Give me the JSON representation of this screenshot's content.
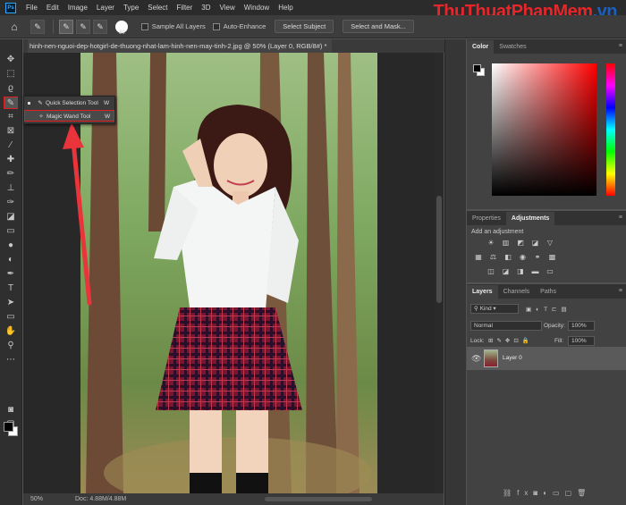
{
  "app": {
    "logo": "Ps",
    "menu": [
      "File",
      "Edit",
      "Image",
      "Layer",
      "Type",
      "Select",
      "Filter",
      "3D",
      "View",
      "Window",
      "Help"
    ],
    "watermark": {
      "part1": "ThuThuat",
      "part2": "PhanMem",
      "part3": ".vn"
    }
  },
  "options": {
    "brush_size": "30",
    "sample_all_layers": "Sample All Layers",
    "auto_enhance": "Auto-Enhance",
    "select_subject": "Select Subject",
    "select_and_mask": "Select and Mask..."
  },
  "document": {
    "tab_title": "hinh-nen-nguoi-dep-hotgirl-de-thuong-nhat-lam-hinh-nen-may-tinh-2.jpg @ 50% (Layer 0, RGB/8#) *",
    "zoom": "50%",
    "doc_size": "Doc: 4.88M/4.88M"
  },
  "flyout": {
    "items": [
      {
        "label": "Quick Selection Tool",
        "key": "W",
        "icon": "quick-selection-icon",
        "active": true
      },
      {
        "label": "Magic Wand Tool",
        "key": "W",
        "icon": "magic-wand-icon",
        "highlighted": true
      }
    ]
  },
  "tools": [
    "move-icon",
    "marquee-icon",
    "lasso-icon",
    "quick-selection-icon",
    "crop-icon",
    "frame-icon",
    "eyedropper-icon",
    "healing-icon",
    "brush-icon",
    "stamp-icon",
    "history-brush-icon",
    "eraser-icon",
    "gradient-icon",
    "blur-icon",
    "dodge-icon",
    "pen-icon",
    "type-icon",
    "path-select-icon",
    "rectangle-icon",
    "hand-icon",
    "zoom-icon",
    "more-icon"
  ],
  "color_panel": {
    "tabs": [
      "Color",
      "Swatches"
    ],
    "hue": "#ff0000"
  },
  "adjustments_panel": {
    "tabs": [
      "Properties",
      "Adjustments"
    ],
    "hint": "Add an adjustment"
  },
  "layers_panel": {
    "tabs": [
      "Layers",
      "Channels",
      "Paths"
    ],
    "filter": "Kind",
    "blend_mode": "Normal",
    "opacity_label": "Opacity:",
    "opacity": "100%",
    "lock_label": "Lock:",
    "fill_label": "Fill:",
    "fill": "100%",
    "layers": [
      {
        "name": "Layer 0",
        "visible": true
      }
    ]
  },
  "colors": {
    "accent_red": "#e02020",
    "arrow_red": "#e8343a",
    "panel": "#424242"
  }
}
